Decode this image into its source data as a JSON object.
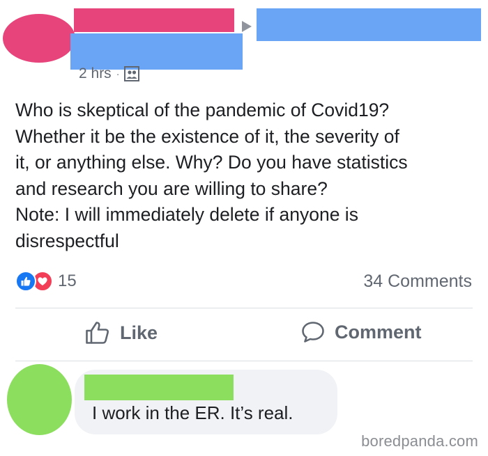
{
  "post": {
    "timestamp": "2 hrs",
    "separator": "·",
    "audience_icon": "group-icon",
    "text_lines": [
      "Who is skeptical of the pandemic of Covid19?",
      "Whether it be the existence of it, the severity of",
      "it, or anything else. Why? Do you have statistics",
      "and research you are willing to share?",
      "Note: I will immediately delete if anyone is",
      "disrespectful"
    ],
    "reaction_count": "15",
    "comment_count": "34 Comments"
  },
  "actions": {
    "like_label": "Like",
    "comment_label": "Comment"
  },
  "comment": {
    "text": "I work in the ER. It’s real."
  },
  "watermark": "boredpanda.com",
  "colors": {
    "author_avatar": "#e6447a",
    "author_name_redaction": "#e6447a",
    "redaction_blue": "#6aa5f5",
    "commenter_avatar": "#8cde5e",
    "commenter_name_redaction": "#8cde5e",
    "like_blue": "#1877f2",
    "love_red": "#f33e58"
  }
}
